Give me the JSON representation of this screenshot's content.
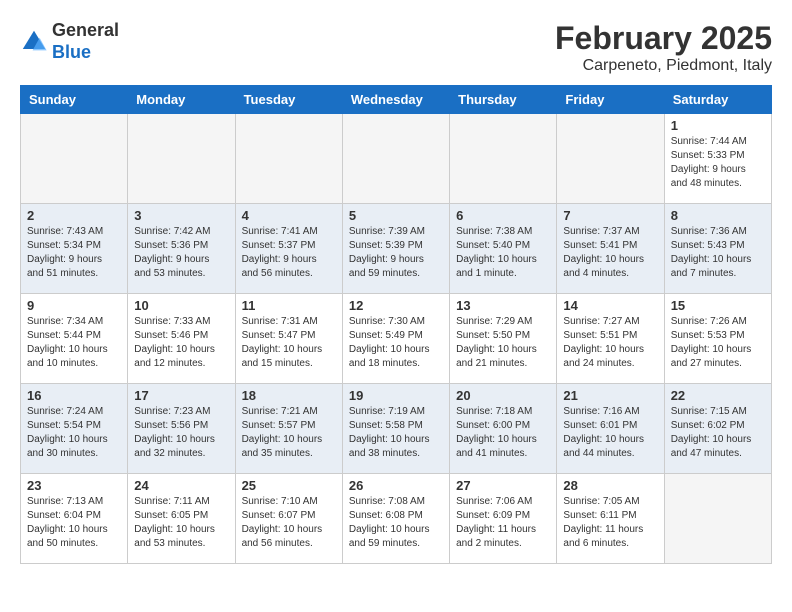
{
  "header": {
    "logo_general": "General",
    "logo_blue": "Blue",
    "month_year": "February 2025",
    "location": "Carpeneto, Piedmont, Italy"
  },
  "days_of_week": [
    "Sunday",
    "Monday",
    "Tuesday",
    "Wednesday",
    "Thursday",
    "Friday",
    "Saturday"
  ],
  "weeks": [
    {
      "days": [
        {
          "num": "",
          "info": ""
        },
        {
          "num": "",
          "info": ""
        },
        {
          "num": "",
          "info": ""
        },
        {
          "num": "",
          "info": ""
        },
        {
          "num": "",
          "info": ""
        },
        {
          "num": "",
          "info": ""
        },
        {
          "num": "1",
          "info": "Sunrise: 7:44 AM\nSunset: 5:33 PM\nDaylight: 9 hours and 48 minutes."
        }
      ]
    },
    {
      "days": [
        {
          "num": "2",
          "info": "Sunrise: 7:43 AM\nSunset: 5:34 PM\nDaylight: 9 hours and 51 minutes."
        },
        {
          "num": "3",
          "info": "Sunrise: 7:42 AM\nSunset: 5:36 PM\nDaylight: 9 hours and 53 minutes."
        },
        {
          "num": "4",
          "info": "Sunrise: 7:41 AM\nSunset: 5:37 PM\nDaylight: 9 hours and 56 minutes."
        },
        {
          "num": "5",
          "info": "Sunrise: 7:39 AM\nSunset: 5:39 PM\nDaylight: 9 hours and 59 minutes."
        },
        {
          "num": "6",
          "info": "Sunrise: 7:38 AM\nSunset: 5:40 PM\nDaylight: 10 hours and 1 minute."
        },
        {
          "num": "7",
          "info": "Sunrise: 7:37 AM\nSunset: 5:41 PM\nDaylight: 10 hours and 4 minutes."
        },
        {
          "num": "8",
          "info": "Sunrise: 7:36 AM\nSunset: 5:43 PM\nDaylight: 10 hours and 7 minutes."
        }
      ]
    },
    {
      "days": [
        {
          "num": "9",
          "info": "Sunrise: 7:34 AM\nSunset: 5:44 PM\nDaylight: 10 hours and 10 minutes."
        },
        {
          "num": "10",
          "info": "Sunrise: 7:33 AM\nSunset: 5:46 PM\nDaylight: 10 hours and 12 minutes."
        },
        {
          "num": "11",
          "info": "Sunrise: 7:31 AM\nSunset: 5:47 PM\nDaylight: 10 hours and 15 minutes."
        },
        {
          "num": "12",
          "info": "Sunrise: 7:30 AM\nSunset: 5:49 PM\nDaylight: 10 hours and 18 minutes."
        },
        {
          "num": "13",
          "info": "Sunrise: 7:29 AM\nSunset: 5:50 PM\nDaylight: 10 hours and 21 minutes."
        },
        {
          "num": "14",
          "info": "Sunrise: 7:27 AM\nSunset: 5:51 PM\nDaylight: 10 hours and 24 minutes."
        },
        {
          "num": "15",
          "info": "Sunrise: 7:26 AM\nSunset: 5:53 PM\nDaylight: 10 hours and 27 minutes."
        }
      ]
    },
    {
      "days": [
        {
          "num": "16",
          "info": "Sunrise: 7:24 AM\nSunset: 5:54 PM\nDaylight: 10 hours and 30 minutes."
        },
        {
          "num": "17",
          "info": "Sunrise: 7:23 AM\nSunset: 5:56 PM\nDaylight: 10 hours and 32 minutes."
        },
        {
          "num": "18",
          "info": "Sunrise: 7:21 AM\nSunset: 5:57 PM\nDaylight: 10 hours and 35 minutes."
        },
        {
          "num": "19",
          "info": "Sunrise: 7:19 AM\nSunset: 5:58 PM\nDaylight: 10 hours and 38 minutes."
        },
        {
          "num": "20",
          "info": "Sunrise: 7:18 AM\nSunset: 6:00 PM\nDaylight: 10 hours and 41 minutes."
        },
        {
          "num": "21",
          "info": "Sunrise: 7:16 AM\nSunset: 6:01 PM\nDaylight: 10 hours and 44 minutes."
        },
        {
          "num": "22",
          "info": "Sunrise: 7:15 AM\nSunset: 6:02 PM\nDaylight: 10 hours and 47 minutes."
        }
      ]
    },
    {
      "days": [
        {
          "num": "23",
          "info": "Sunrise: 7:13 AM\nSunset: 6:04 PM\nDaylight: 10 hours and 50 minutes."
        },
        {
          "num": "24",
          "info": "Sunrise: 7:11 AM\nSunset: 6:05 PM\nDaylight: 10 hours and 53 minutes."
        },
        {
          "num": "25",
          "info": "Sunrise: 7:10 AM\nSunset: 6:07 PM\nDaylight: 10 hours and 56 minutes."
        },
        {
          "num": "26",
          "info": "Sunrise: 7:08 AM\nSunset: 6:08 PM\nDaylight: 10 hours and 59 minutes."
        },
        {
          "num": "27",
          "info": "Sunrise: 7:06 AM\nSunset: 6:09 PM\nDaylight: 11 hours and 2 minutes."
        },
        {
          "num": "28",
          "info": "Sunrise: 7:05 AM\nSunset: 6:11 PM\nDaylight: 11 hours and 6 minutes."
        },
        {
          "num": "",
          "info": ""
        }
      ]
    }
  ]
}
